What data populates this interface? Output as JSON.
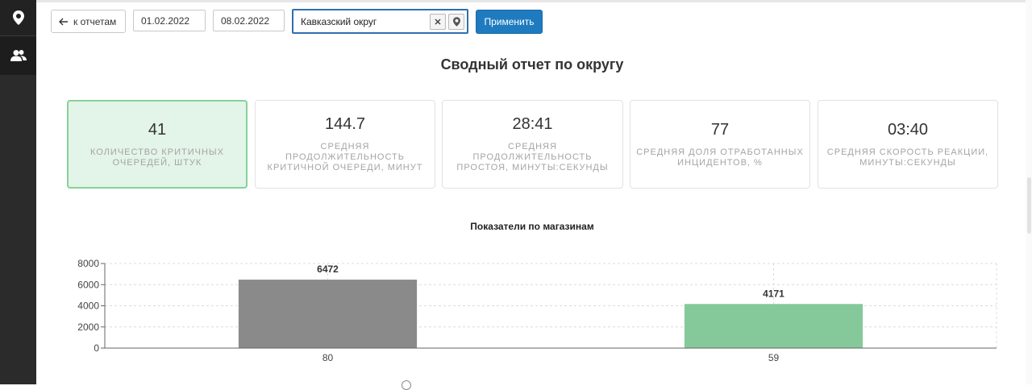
{
  "toolbar": {
    "back_label": "к отчетам",
    "date_from": "01.02.2022",
    "date_to": "08.02.2022",
    "region_value": "Кавказский округ",
    "apply_label": "Применить"
  },
  "page_title": "Сводный отчет по округу",
  "cards": [
    {
      "value": "41",
      "label": "Количество критичных очередей, штук",
      "active": true
    },
    {
      "value": "144.7",
      "label": "Средняя продолжительность критичной очереди, минут",
      "active": false
    },
    {
      "value": "28:41",
      "label": "Средняя продолжительность простоя, минуты:секунды",
      "active": false
    },
    {
      "value": "77",
      "label": "Средняя доля отработанных инцидентов, %",
      "active": false
    },
    {
      "value": "03:40",
      "label": "Средняя скорость реакции, минуты:секунды",
      "active": false
    }
  ],
  "chart_data": {
    "type": "bar",
    "title": "Показатели по магазинам",
    "categories": [
      "80",
      "59"
    ],
    "values": [
      6472,
      4171
    ],
    "colors": [
      "#8a8a8a",
      "#85c99b"
    ],
    "data_labels": [
      "6472",
      "4171"
    ],
    "ylim": [
      0,
      8000
    ],
    "yticks": [
      0,
      2000,
      4000,
      6000,
      8000
    ],
    "grid": true,
    "xlabel": "",
    "ylabel": ""
  }
}
